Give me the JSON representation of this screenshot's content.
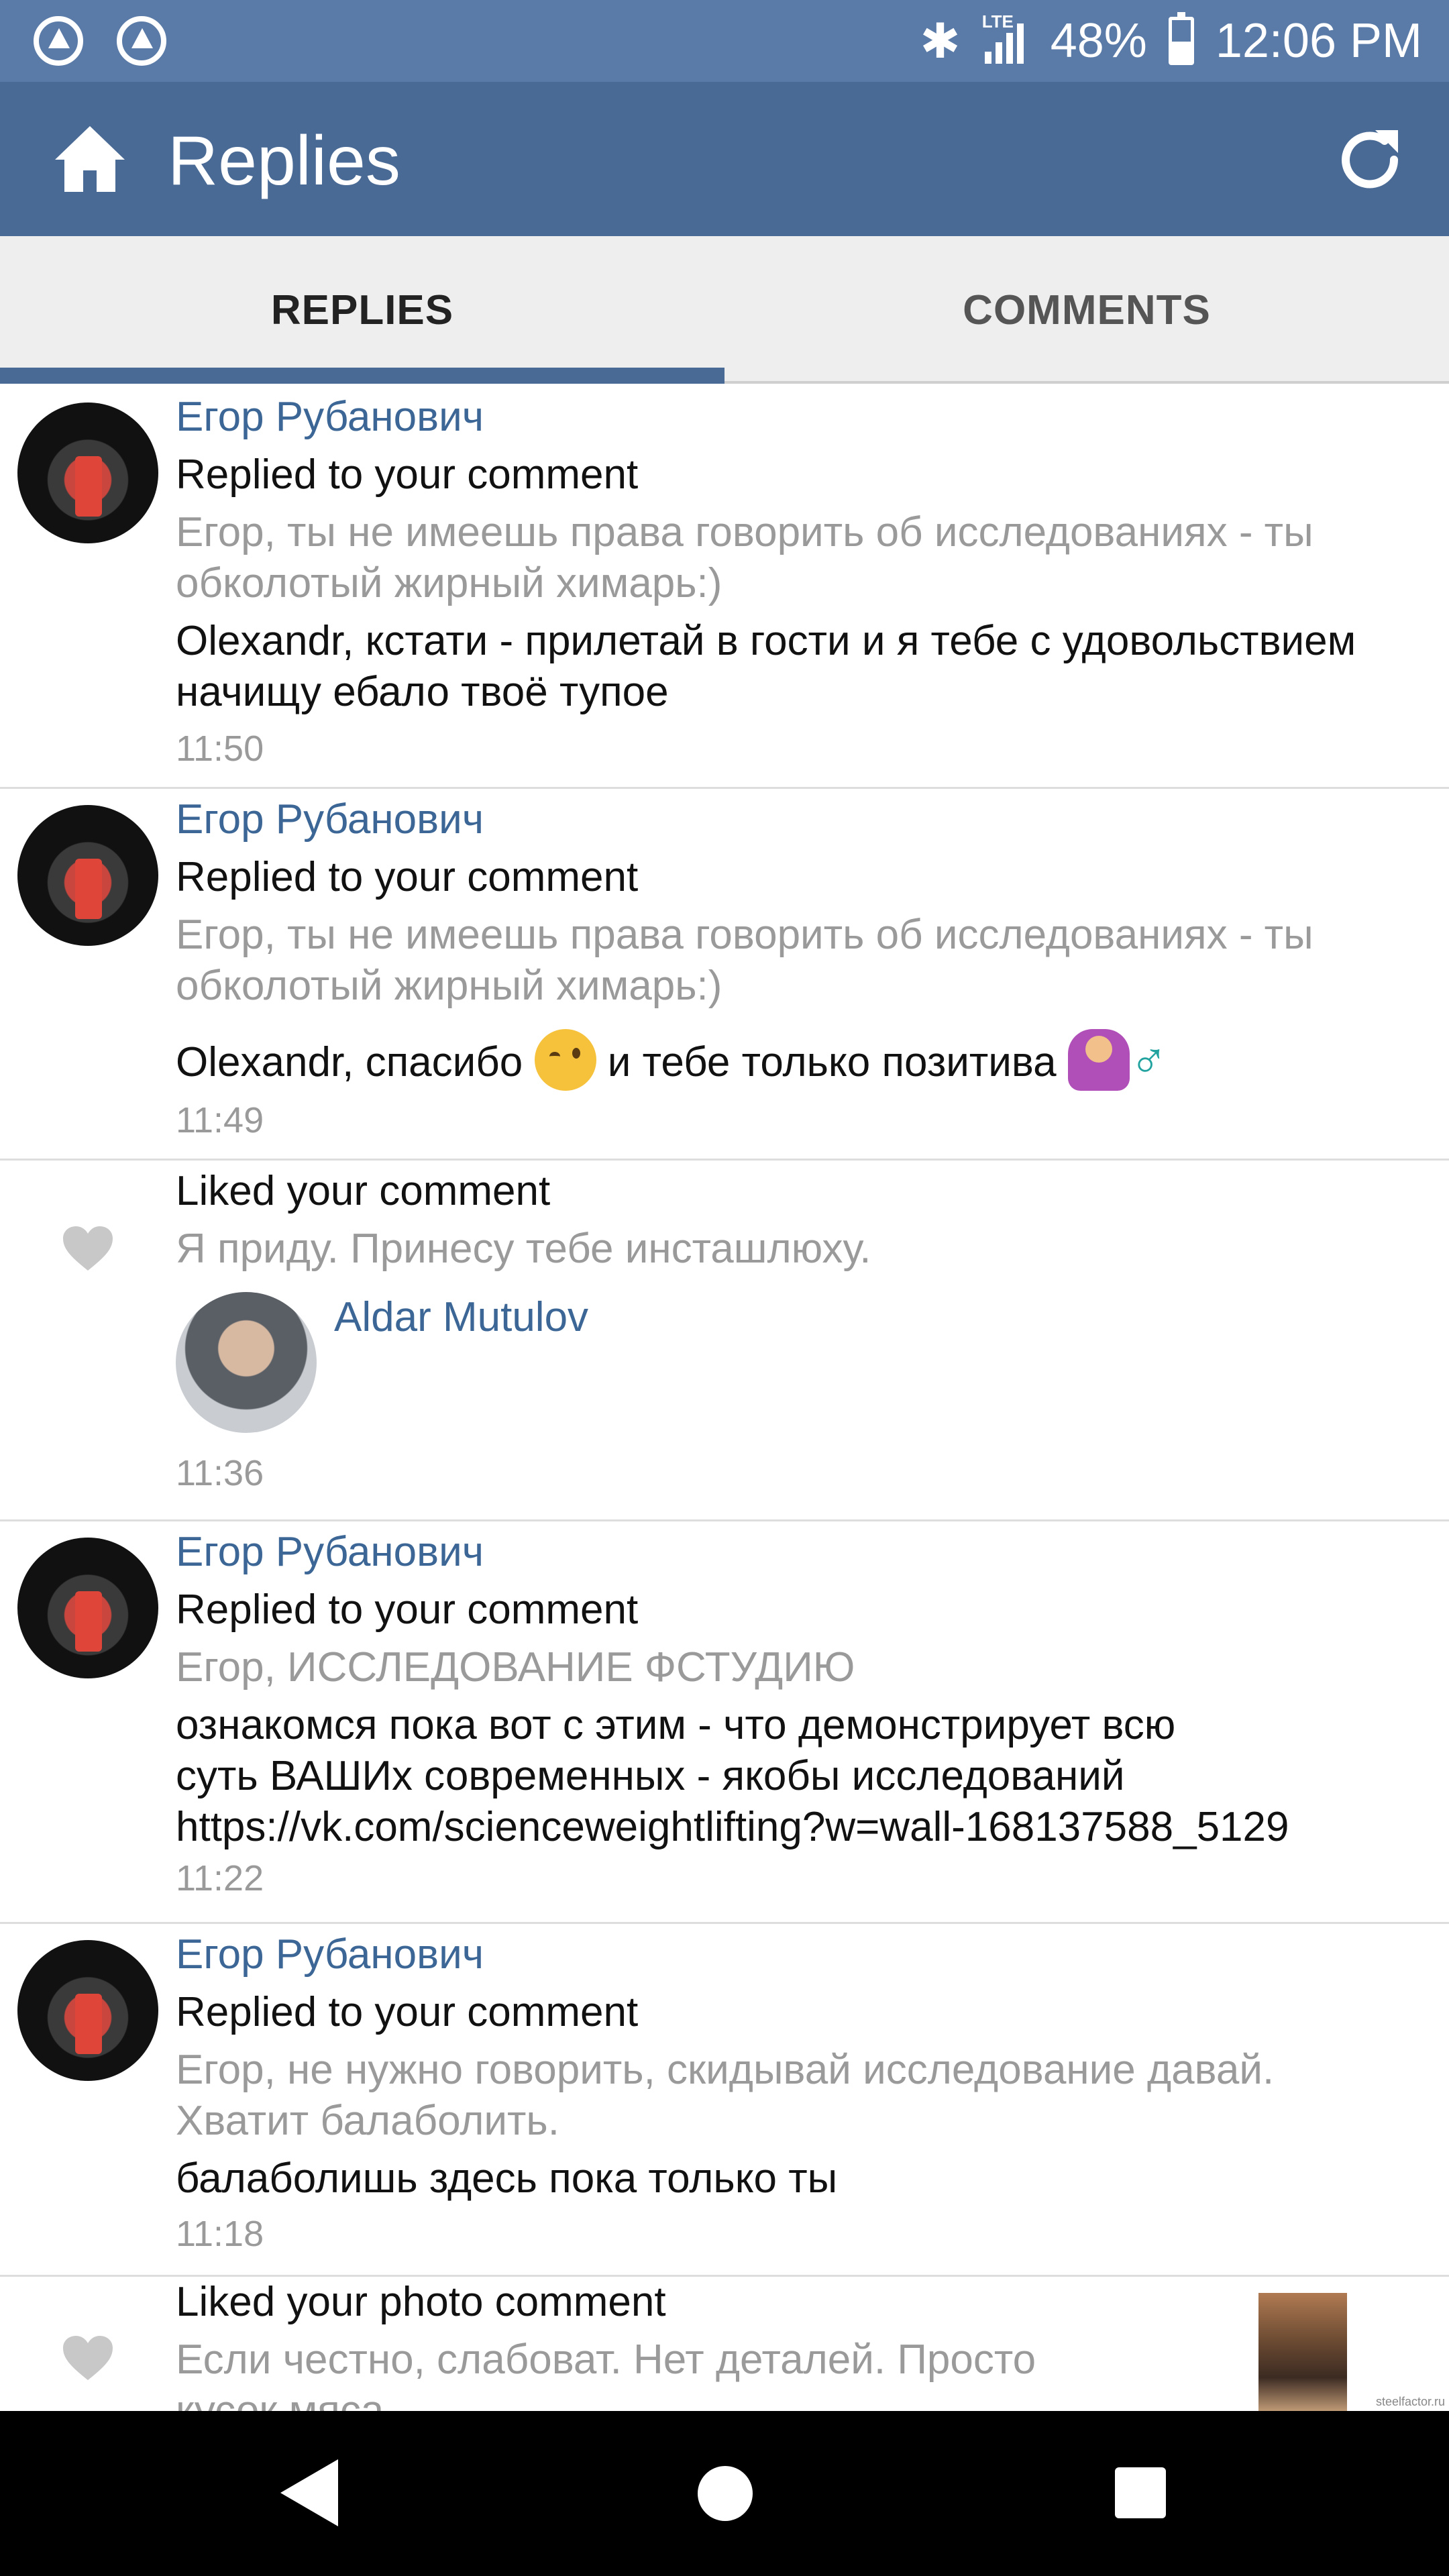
{
  "status_bar": {
    "network": "LTE",
    "battery": "48%",
    "time": "12:06 PM"
  },
  "app_bar": {
    "title": "Replies"
  },
  "tabs": [
    {
      "label": "REPLIES",
      "selected": true
    },
    {
      "label": "COMMENTS",
      "selected": false
    }
  ],
  "feed": [
    {
      "author": "Егор Рубанович",
      "action": "Replied to your comment",
      "quote": "Егор, ты не имеешь права говорить об исследованиях - ты обколотый жирный химарь:)",
      "reply": "Olexandr, кстати - прилетай в гости и я тебе с удовольствием начищу ебало твоё тупое",
      "time": "11:50"
    },
    {
      "author": "Егор Рубанович",
      "action": "Replied to your comment",
      "quote": "Егор, ты не имеешь права говорить об исследованиях - ты обколотый жирный химарь:)",
      "reply_part1": "Olexandr, спасибо",
      "reply_part2": "и тебе только позитива",
      "reply_male_sign": "♂",
      "time": "11:49"
    },
    {
      "action": "Liked your comment",
      "quote": "Я приду.  Принесу тебе инсташлюху.",
      "liker": "Aldar Mutulov",
      "time": "11:36"
    },
    {
      "author": "Егор Рубанович",
      "action": "Replied to your comment",
      "quote": "Егор, ИССЛЕДОВАНИЕ ФСТУДИЮ",
      "reply_lines": [
        "ознакомся пока вот с этим - что демонстрирует всю",
        "суть ВАШИх современных - якобы исследований",
        "https://vk.com/scienceweightlifting?w=wall-168137588_5129"
      ],
      "time": "11:22"
    },
    {
      "author": "Егор Рубанович",
      "action": "Replied to your comment",
      "quote_lines": [
        "Егор, не нужно говорить, скидывай исследование давай.",
        "Хватит балаболить."
      ],
      "reply": "балаболишь здесь пока только ты",
      "time": "11:18"
    },
    {
      "action": "Liked your photo comment",
      "quote": "Если честно, слабоват. Нет деталей.  Просто",
      "quote_cut": "кусок мяса"
    }
  ],
  "watermark": "steelfactor.ru"
}
